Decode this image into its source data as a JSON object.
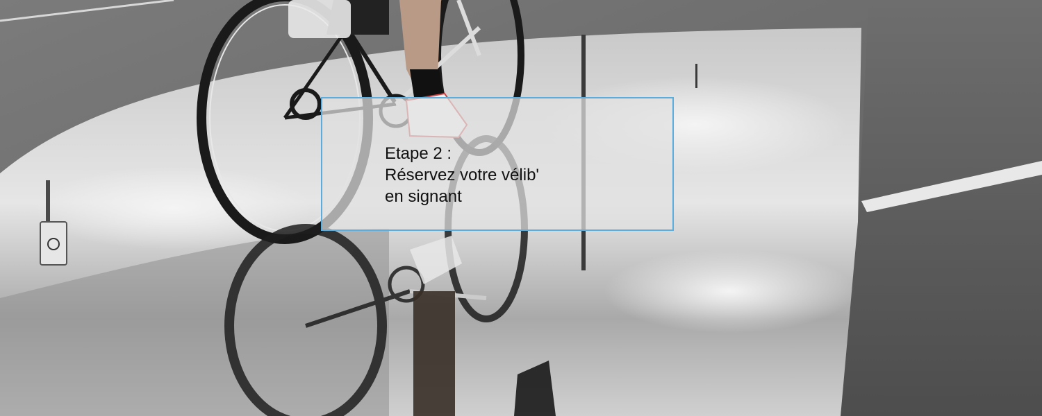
{
  "slide": {
    "step_label": "Etape 2 :",
    "title_line1": "Réservez votre vélib'",
    "title_line2": "en signant"
  },
  "colors": {
    "caption_border": "#5aaedd",
    "caption_text": "#111111"
  },
  "icons": {
    "background": "cyclist-puddle-photo"
  }
}
